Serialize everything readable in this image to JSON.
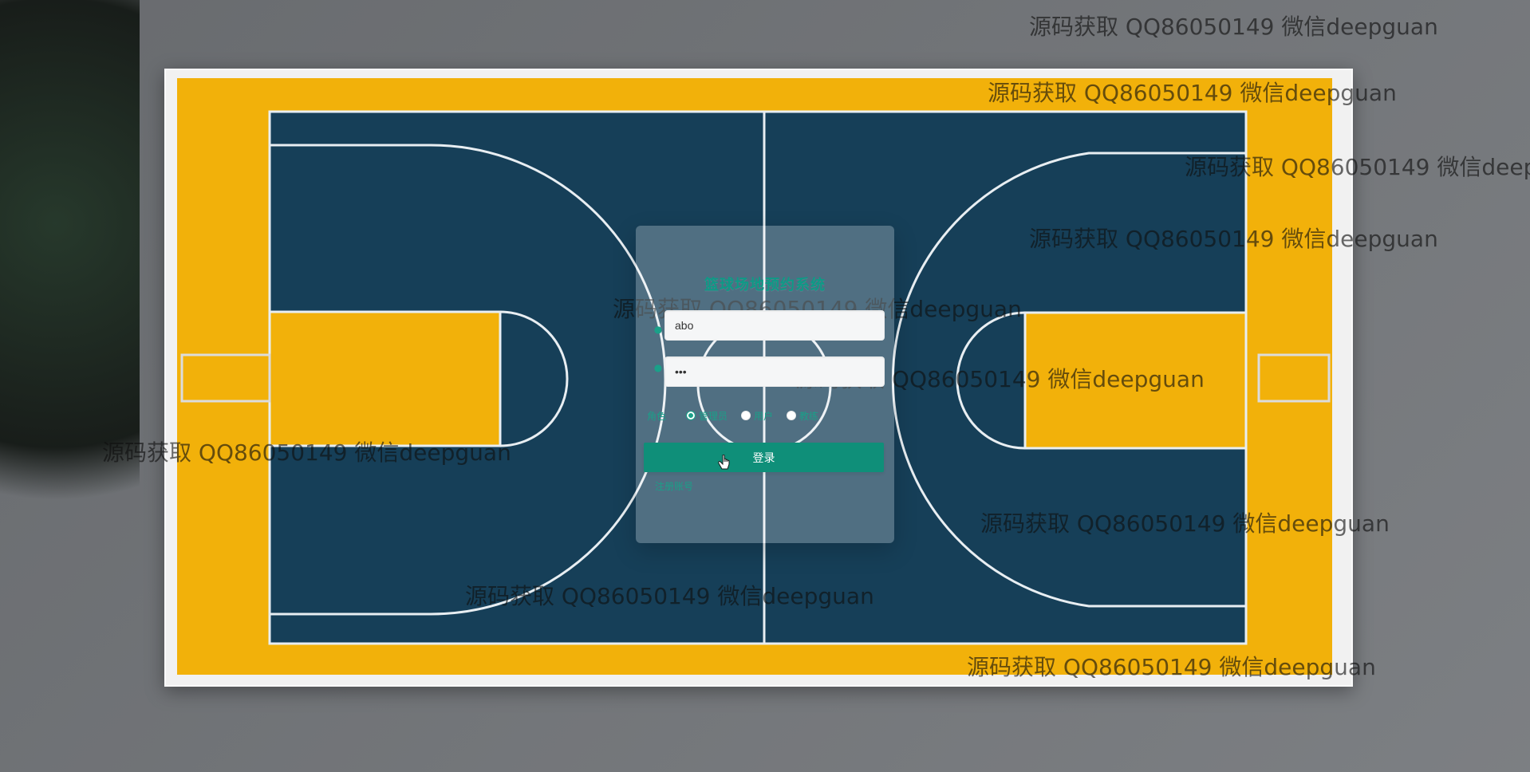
{
  "login": {
    "title": "篮球场地预约系统",
    "username_value": "abo",
    "password_value": "•••",
    "role_label": "角色",
    "roles": [
      {
        "label": "管理员",
        "checked": true
      },
      {
        "label": "用户",
        "checked": false
      },
      {
        "label": "教练",
        "checked": false
      }
    ],
    "login_button": "登录",
    "register_link": "注册账号"
  },
  "watermark": {
    "text": "源码获取 QQ86050149 微信deepguan"
  },
  "colors": {
    "accent": "#0f8f79",
    "accent_text": "#1aa089"
  }
}
